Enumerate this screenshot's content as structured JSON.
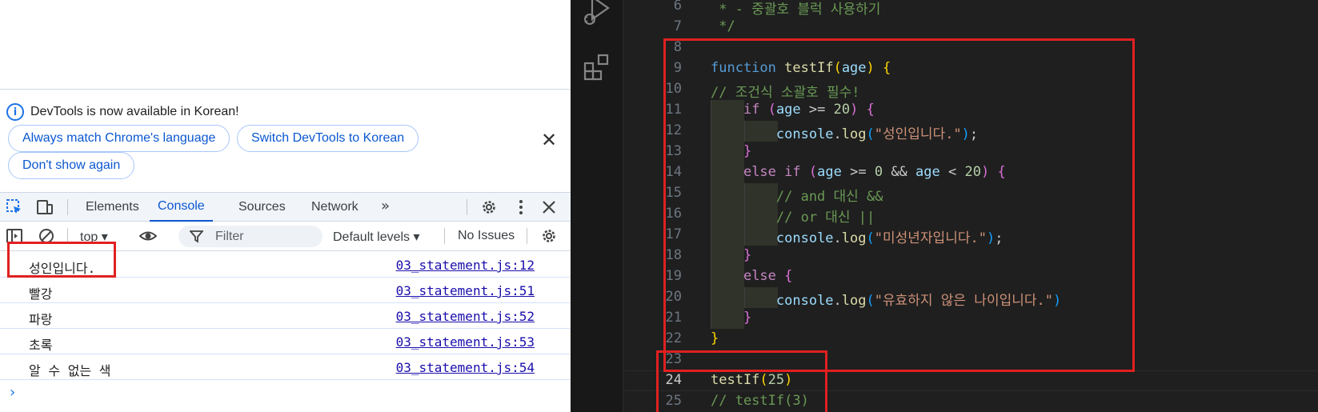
{
  "devtools": {
    "infobar": {
      "message": "DevTools is now available in Korean!",
      "btn_match": "Always match Chrome's language",
      "btn_switch": "Switch DevTools to Korean",
      "btn_dont_show": "Don't show again",
      "close_glyph": "✕"
    },
    "tabs": [
      {
        "label": "Elements",
        "active": false
      },
      {
        "label": "Console",
        "active": true
      },
      {
        "label": "Sources",
        "active": false
      },
      {
        "label": "Network",
        "active": false
      }
    ],
    "more_tabs_glyph": "»",
    "toolbar": {
      "context": "top ▾",
      "filter_placeholder": "Filter",
      "levels": "Default levels ▾",
      "issues": "No Issues"
    },
    "logs": [
      {
        "message": "성인입니다.",
        "source": "03_statement.js:12"
      },
      {
        "message": "빨강",
        "source": "03_statement.js:51"
      },
      {
        "message": "파랑",
        "source": "03_statement.js:52"
      },
      {
        "message": "초록",
        "source": "03_statement.js:53"
      },
      {
        "message": "알 수 없는 색",
        "source": "03_statement.js:54"
      }
    ],
    "prompt_glyph": "›",
    "accent_color": "#0b57d0"
  },
  "editor": {
    "lines": [
      {
        "num": "6",
        "text": " * - 중괄호 블럭 사용하기"
      },
      {
        "num": "7",
        "text": " */"
      },
      {
        "num": "8",
        "text": ""
      },
      {
        "num": "9",
        "text": "function testIf(age) {"
      },
      {
        "num": "10",
        "text": "// 조건식 소괄호 필수!"
      },
      {
        "num": "11",
        "text": "    if (age >= 20) {"
      },
      {
        "num": "12",
        "text": "        console.log(\"성인입니다.\");"
      },
      {
        "num": "13",
        "text": "    }"
      },
      {
        "num": "14",
        "text": "    else if (age >= 0 && age < 20) {"
      },
      {
        "num": "15",
        "text": "        // and 대신 &&"
      },
      {
        "num": "16",
        "text": "        // or 대신 ||"
      },
      {
        "num": "17",
        "text": "        console.log(\"미성년자입니다.\");"
      },
      {
        "num": "18",
        "text": "    }"
      },
      {
        "num": "19",
        "text": "    else {"
      },
      {
        "num": "20",
        "text": "        console.log(\"유효하지 않은 나이입니다.\")"
      },
      {
        "num": "21",
        "text": "    }"
      },
      {
        "num": "22",
        "text": "}"
      },
      {
        "num": "23",
        "text": ""
      },
      {
        "num": "24",
        "text": "testIf(25)"
      },
      {
        "num": "25",
        "text": "// testIf(3)"
      }
    ],
    "current_line": "24",
    "background": "#1f1f1f",
    "highlight_color": "#e02020"
  }
}
